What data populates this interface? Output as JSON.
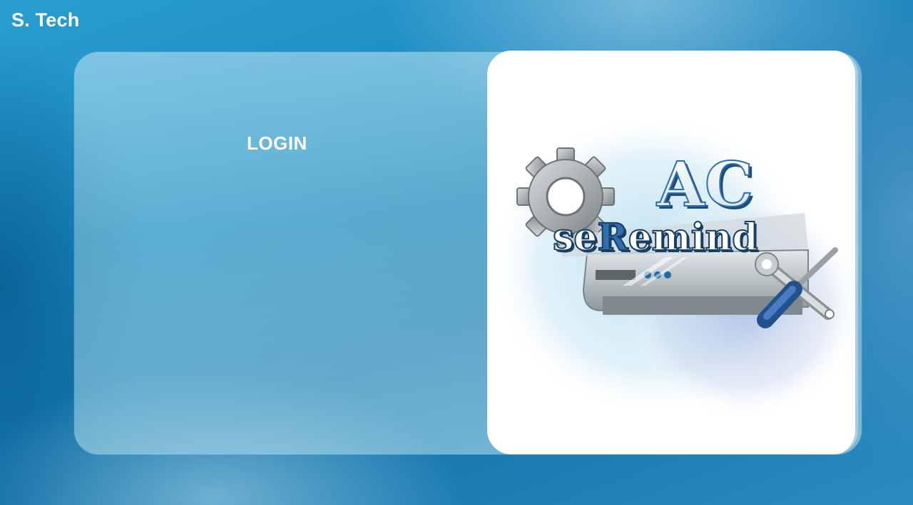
{
  "brand": {
    "name": "S. Tech"
  },
  "login": {
    "title": "LOGIN"
  },
  "logo": {
    "line1": "AC",
    "line2_pre": "se",
    "line2_accent": "R",
    "line2_post": "emind",
    "icons": [
      "gear-icon",
      "air-conditioner-icon",
      "wrench-icon",
      "screwdriver-icon"
    ]
  },
  "colors": {
    "accent_blue": "#2f6fb0",
    "text_white": "#ffffff"
  }
}
